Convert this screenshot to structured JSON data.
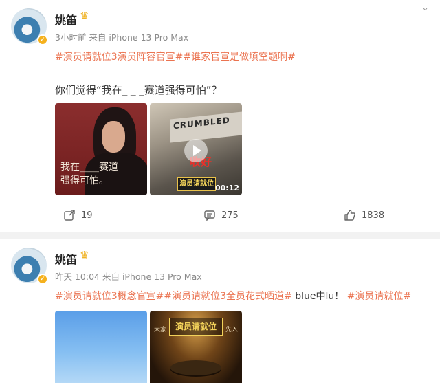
{
  "posts": [
    {
      "author": "姚笛",
      "meta": "3小时前  来自 iPhone 13 Pro Max",
      "tags": [
        "#演员请就位3演员阵容官宣#",
        "#谁家官宣是做填空题啊#"
      ],
      "text": "你们觉得“我在_ _ _赛道强得可怕”？",
      "media": [
        {
          "type": "image",
          "line1": "我在____赛道",
          "line2": "强得可怕。"
        },
        {
          "type": "video",
          "sign": "CRUMBLED",
          "overlay": "收好",
          "logo": "演员请就位",
          "duration": "00:12"
        }
      ],
      "actions": {
        "reposts": "19",
        "comments": "275",
        "likes": "1838"
      }
    },
    {
      "author": "姚笛",
      "meta": "昨天 10:04  来自 iPhone 13 Pro Max",
      "tags": [
        "#演员请就位3概念官宣#",
        "#演员请就位3全员花式晒道#",
        " blue中lu！",
        "#演员请就位#"
      ],
      "media": [
        {
          "type": "image"
        },
        {
          "type": "image",
          "logo": "演员请就位",
          "left": "大家",
          "right": "先入"
        }
      ]
    }
  ],
  "colors": {
    "accent": "#eb7350",
    "verified": "#f5b11d"
  },
  "icons": [
    "avatar",
    "crown-icon",
    "verified-icon",
    "repost-icon",
    "comment-icon",
    "like-icon",
    "play-icon",
    "chevron-down-icon"
  ]
}
